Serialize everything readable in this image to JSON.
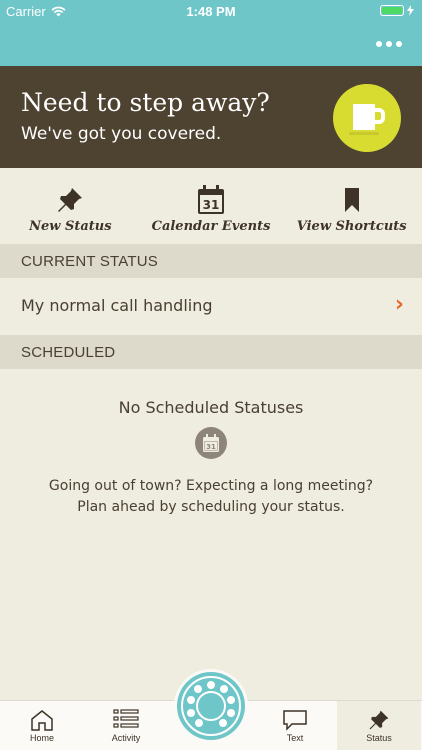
{
  "status_bar": {
    "carrier": "Carrier",
    "time": "1:48 PM"
  },
  "hero": {
    "title": "Need to step away?",
    "subtitle": "We've got you covered."
  },
  "shortcuts": [
    {
      "label": "New Status",
      "icon": "pin-icon"
    },
    {
      "label": "Calendar Events",
      "icon": "calendar-icon",
      "badge": "31"
    },
    {
      "label": "View Shortcuts",
      "icon": "bookmark-icon"
    }
  ],
  "current_status": {
    "header": "CURRENT STATUS",
    "value": "My normal call handling",
    "chevron": "›"
  },
  "scheduled": {
    "header": "SCHEDULED",
    "empty_title": "No Scheduled Statuses",
    "empty_icon_badge": "31",
    "empty_line1": "Going out of town? Expecting a long meeting?",
    "empty_line2": "Plan ahead by scheduling your status."
  },
  "tabs": [
    {
      "label": "Home",
      "icon": "home-icon"
    },
    {
      "label": "Activity",
      "icon": "list-icon"
    },
    {
      "label": "Text",
      "icon": "chat-icon"
    },
    {
      "label": "Status",
      "icon": "pin-icon",
      "active": true
    }
  ],
  "colors": {
    "teal": "#6fc6c9",
    "brown": "#4e4231",
    "lime": "#d8dc30",
    "orange": "#e36b2a",
    "cream": "#efece0"
  }
}
